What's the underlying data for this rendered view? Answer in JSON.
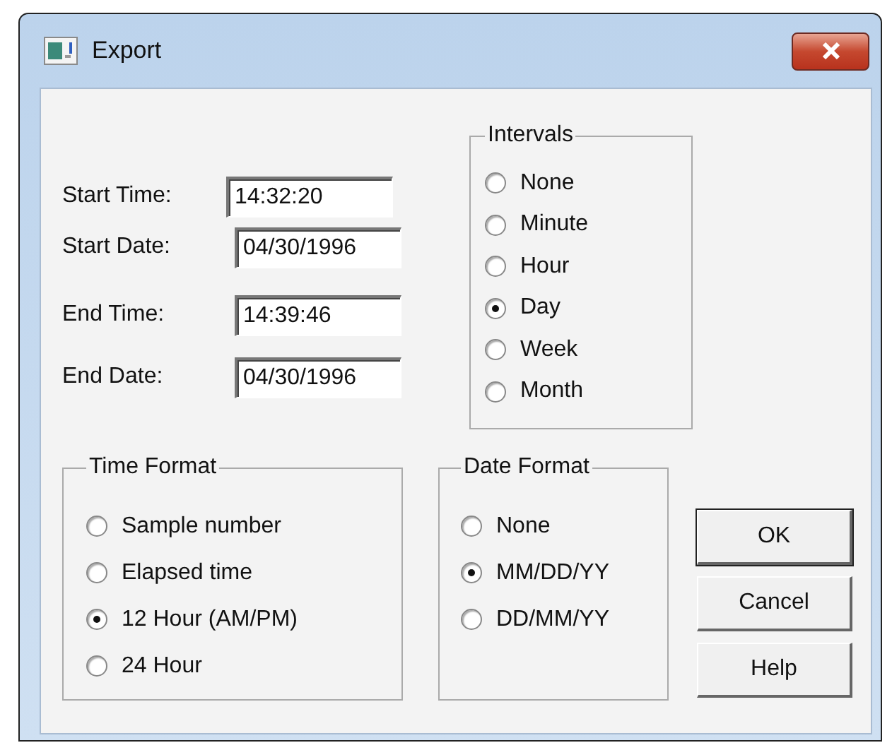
{
  "window": {
    "title": "Export"
  },
  "fields": [
    {
      "label": "Start Time:",
      "value": "14:32:20"
    },
    {
      "label": "Start Date:",
      "value": "04/30/1996"
    },
    {
      "label": "End Time:",
      "value": "14:39:46"
    },
    {
      "label": "End Date:",
      "value": "04/30/1996"
    }
  ],
  "intervals": {
    "title": "Intervals",
    "options": [
      {
        "label": "None",
        "selected": false
      },
      {
        "label": "Minute",
        "selected": false
      },
      {
        "label": "Hour",
        "selected": false
      },
      {
        "label": "Day",
        "selected": true
      },
      {
        "label": "Week",
        "selected": false
      },
      {
        "label": "Month",
        "selected": false
      }
    ]
  },
  "time_format": {
    "title": "Time Format",
    "options": [
      {
        "label": "Sample number",
        "selected": false
      },
      {
        "label": "Elapsed time",
        "selected": false
      },
      {
        "label": "12 Hour (AM/PM)",
        "selected": true
      },
      {
        "label": "24 Hour",
        "selected": false
      }
    ]
  },
  "date_format": {
    "title": "Date Format",
    "options": [
      {
        "label": "None",
        "selected": false
      },
      {
        "label": "MM/DD/YY",
        "selected": true
      },
      {
        "label": "DD/MM/YY",
        "selected": false
      }
    ]
  },
  "buttons": [
    "OK",
    "Cancel",
    "Help"
  ]
}
